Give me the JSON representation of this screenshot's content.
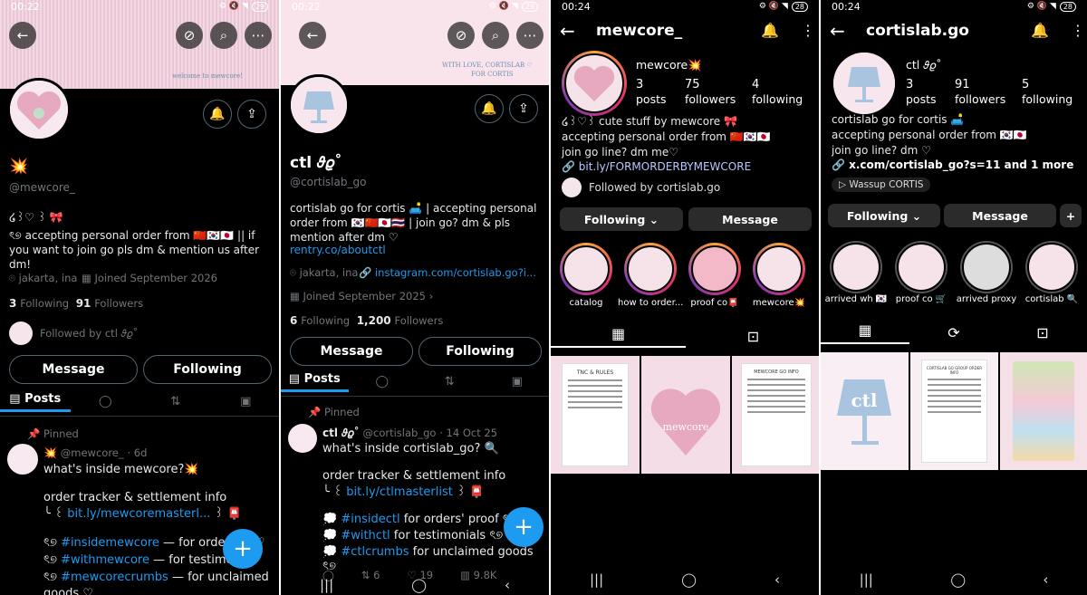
{
  "panel1": {
    "status": {
      "time": "00:22",
      "battery": "29"
    },
    "banner_text": "welcome to mewcore!",
    "name_icon": "💥",
    "handle": "@mewcore_",
    "bio_line1": "໒꒱♡ ꒱ 🎀",
    "bio_line2": "ৎ୭ accepting personal order from 🇨🇳🇰🇷🇯🇵 || if you want to join go pls dm & mention us after dm!",
    "location": "jakarta, ina",
    "joined": "Joined September 2026",
    "following_count": "3",
    "following_label": "Following",
    "followers_count": "91",
    "followers_label": "Followers",
    "followed_by": "Followed by ctl 𝜗𝜚˚",
    "message_label": "Message",
    "following_btn": "Following",
    "tabs": [
      "Posts"
    ],
    "pinned_label": "Pinned",
    "post_author_icon": "💥",
    "post_handle": "@mewcore_",
    "post_time": "· 6d",
    "post_line1": "what's inside mewcore?💥",
    "post_line2": "order tracker & settlement info",
    "post_line3_prefix": "╰ ꒰",
    "post_link": "bit.ly/mewcoremasterl...",
    "post_line3_suffix": "꒱ 📮",
    "tag1_prefix": "ৎ୭",
    "tag1": "#insidemewcore",
    "tag1_text": " — for order's p ♡",
    "tag2_prefix": "ৎ୭",
    "tag2": "#withmewcore",
    "tag2_text": " — for testimon",
    "tag3_prefix": "ৎ୭",
    "tag3": "#mewcorecrumbs",
    "tag3_text": " — for unclaimed",
    "post_tail": "goods ♡"
  },
  "panel2": {
    "status": {
      "time": "00:22",
      "battery": "29"
    },
    "banner_text1": "WITH LOVE, CORTISLAB ♡",
    "banner_text2": "FOR CORTIS",
    "name": "ctl 𝜗𝜚˚",
    "handle": "@cortislab_go",
    "bio": "cortislab go for cortis 🛋️ | accepting personal order from 🇰🇷🇨🇳🇯🇵🇹🇭 | join go? dm & pls mention after dm ♡",
    "bio_link": "rentry.co/aboutctl",
    "location": "jakarta, ina",
    "ig_link": "instagram.com/cortislab.go?i...",
    "joined": "Joined September 2025",
    "following_count": "6",
    "following_label": "Following",
    "followers_count": "1,200",
    "followers_label": "Followers",
    "message_label": "Message",
    "following_btn": "Following",
    "tabs": [
      "Posts"
    ],
    "pinned_label": "Pinned",
    "post_name": "ctl 𝜗𝜚˚",
    "post_handle": "@cortislab_go",
    "post_time": "· 14 Oct 25",
    "post_line1": "what's inside cortislab_go? 🔍",
    "post_line2": "order tracker & settlement info",
    "post_line3_prefix": "╰ ꒰",
    "post_link": "bit.ly/ctlmasterlist",
    "post_line3_suffix": "꒱ 📮",
    "tag1_prefix": "💭",
    "tag1": "#insidectl",
    "tag1_text": " for orders' proof ৎ୭",
    "tag2_prefix": "💭",
    "tag2": "#withctl",
    "tag2_text": " for testimonials ৎ୭",
    "tag3_prefix": "💭",
    "tag3": "#ctlcrumbs",
    "tag3_text": " for unclaimed goods ৎ୭",
    "stat_retweets": "6",
    "stat_likes": "19",
    "stat_views": "9.8K"
  },
  "panel3": {
    "status": {
      "time": "00:24",
      "battery": "28"
    },
    "username": "mewcore_",
    "display_name": "mewcore💥",
    "posts_count": "3",
    "posts_label": "posts",
    "followers_count": "75",
    "followers_label": "followers",
    "following_count": "4",
    "following_label": "following",
    "bio1": "໒꒱♡꒱ cute stuff by mewcore 🎀",
    "bio2": "accepting personal order from 🇨🇳🇰🇷🇯🇵",
    "bio3": "join go line? dm me♡",
    "link": "bit.ly/FORMORDERBYMEWCORE",
    "followed_by": "Followed by cortislab.go",
    "following_btn": "Following",
    "message_btn": "Message",
    "highlights": [
      "catalog",
      "how to order...",
      "proof co📮",
      "mewcore💥"
    ],
    "grid1_title": "TNC & RULES",
    "grid2_text": "mewcore",
    "grid3_title": "MEWCORE GO INFO"
  },
  "panel4": {
    "status": {
      "time": "00:24",
      "battery": "28"
    },
    "username": "cortislab.go",
    "display_name": "ctl 𝜗𝜚˚",
    "posts_count": "3",
    "posts_label": "posts",
    "followers_count": "91",
    "followers_label": "followers",
    "following_count": "5",
    "following_label": "following",
    "bio1": "cortislab go for cortis 🛋️",
    "bio2": "accepting personal order from 🇰🇷🇯🇵",
    "bio3": "join go line? dm ♡",
    "link": "x.com/cortislab_go?s=11 and 1 more",
    "music": "Wassup  CORTIS",
    "following_btn": "Following",
    "message_btn": "Message",
    "highlights": [
      "arrived wh 🇰🇷",
      "proof co 🛒",
      "arrived proxy",
      "cortislab 🔍"
    ],
    "grid1_text": "ctl",
    "grid2_title": "CORTISLAB GO GROUP ORDER INFO"
  }
}
